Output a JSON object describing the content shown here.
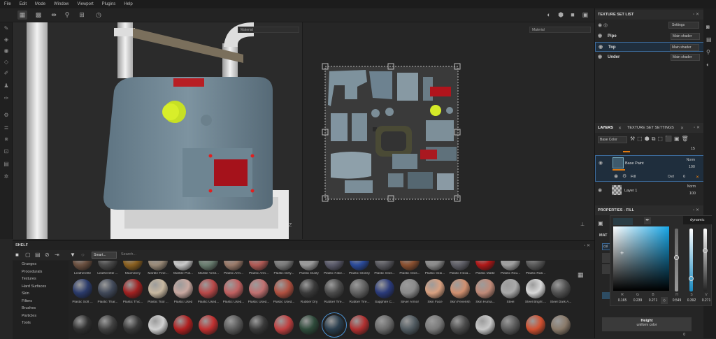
{
  "menubar": [
    "File",
    "Edit",
    "Mode",
    "Window",
    "Viewport",
    "Plugins",
    "Help"
  ],
  "viewport": {
    "left_mode": "Material",
    "right_mode": "Material"
  },
  "shelf": {
    "title": "SHELF",
    "search_chip": "Smart...",
    "search_placeholder": "Search...",
    "categories": [
      "Grunges",
      "Procedurals",
      "Textures",
      "Hard Surfaces",
      "Skin",
      "Filters",
      "Brushes",
      "Particles",
      "Tools"
    ],
    "row1_labels": [
      "Leatherette",
      "Leatherette ...",
      "Machinery",
      "Marble Fine...",
      "Marble Poli...",
      "Marble Verd...",
      "Plastic Arm...",
      "Plastic Arm...",
      "Plastic Dirty...",
      "Plastic Dusty",
      "Plastic Fake...",
      "Plastic Glossy",
      "Plastic Glos...",
      "Plastic Glos...",
      "Plastic Grai...",
      "Plastic Hexa...",
      "Plastic Matte",
      "Plastic Rou...",
      "Plastic Rub..."
    ],
    "row2_labels": [
      "Plastic Soft ...",
      "Plastic Thar...",
      "Plastic Thic...",
      "Plastic Tool ...",
      "Plastic Used",
      "Plastic Used...",
      "Plastic Used...",
      "Plastic Used...",
      "Plastic Used...",
      "Rubber Dry",
      "Rubber Tire...",
      "Rubber Tire...",
      "Sapphire C...",
      "Silver Armor",
      "Skin Face",
      "Skin Feverish",
      "Skin Huma...",
      "Steel",
      "Steel Bright ...",
      "Steel Dark A..."
    ]
  },
  "texture_set_list": {
    "title": "TEXTURE SET LIST",
    "settings": "Settings",
    "rows": [
      {
        "name": "Pipe",
        "shader": "Main shader"
      },
      {
        "name": "Top",
        "shader": "Main shader"
      },
      {
        "name": "Under",
        "shader": "Main shader"
      }
    ]
  },
  "layers": {
    "tab_layers": "LAYERS",
    "tab_settings": "TEXTURE SET SETTINGS",
    "channel": "Base Color",
    "top_opacity": "15",
    "items": [
      {
        "name": "Base Paint",
        "blend": "Norm",
        "opacity": "100"
      },
      {
        "name": "Fill",
        "blend": "Ovrl",
        "opacity": "6"
      },
      {
        "name": "Layer 1",
        "blend": "Norm",
        "opacity": "100"
      }
    ]
  },
  "properties": {
    "title": "PROPERTIES - FILL",
    "mode": "dynamic",
    "mat_prefix": "MAT",
    "col_label": "col",
    "height_label": "Height",
    "uniform_label": "uniform color",
    "bottom_value": "0"
  },
  "color_picker": {
    "labels": [
      "R",
      "G",
      "B",
      "H",
      "S",
      "V"
    ],
    "values": [
      "0.165",
      "0.239",
      "0.271",
      "0.549",
      "0.392",
      "0.271"
    ],
    "swatch": "#2a3d45"
  }
}
